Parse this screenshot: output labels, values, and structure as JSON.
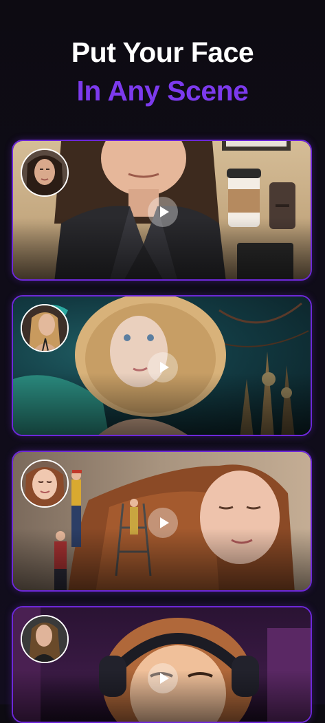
{
  "header": {
    "title_line1": "Put Your Face",
    "title_line2": "In Any Scene"
  },
  "colors": {
    "accent": "#7c3aed",
    "border": "#6d28d9",
    "background": "#0d0b12"
  },
  "cards": [
    {
      "scene": "office-flatlay-portrait",
      "action_icon": "play-icon"
    },
    {
      "scene": "mermaid-underwater-portrait",
      "action_icon": "play-icon"
    },
    {
      "scene": "tiny-painters-hair-portrait",
      "action_icon": "play-icon"
    },
    {
      "scene": "cartoon-headphones-portrait",
      "action_icon": "play-icon"
    }
  ]
}
